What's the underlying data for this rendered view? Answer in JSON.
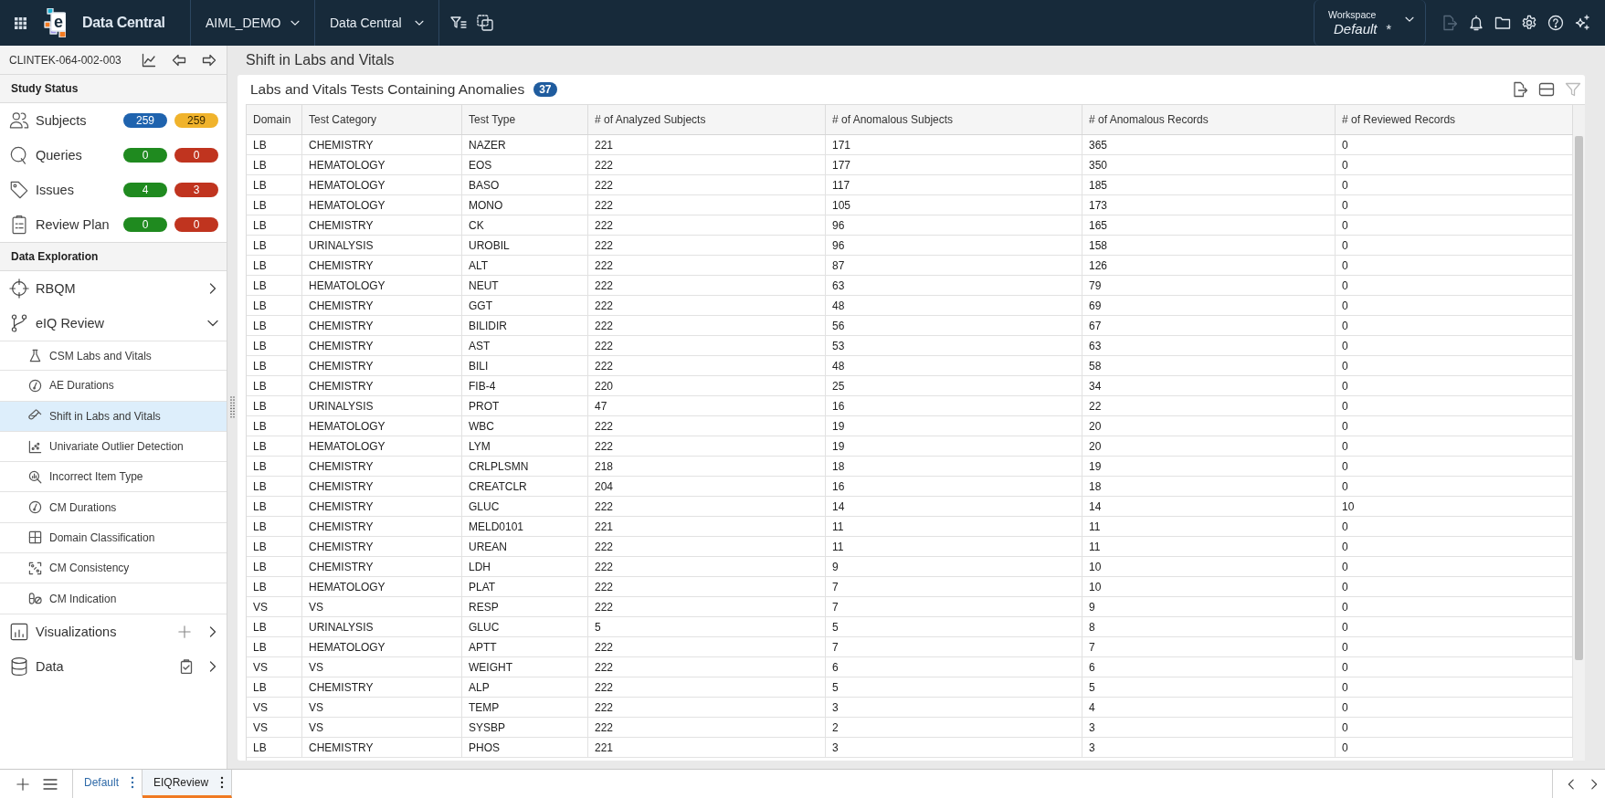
{
  "top_bar": {
    "logo_letter": "e",
    "app_name": "Data Central",
    "selectors": [
      {
        "value": "AIML_DEMO"
      },
      {
        "value": "Data Central"
      }
    ],
    "workspace": {
      "label": "Workspace",
      "value": "Default",
      "unsaved_mark": "*"
    },
    "export_disabled": true
  },
  "sidebar": {
    "study_id": "CLINTEK-064-002-003",
    "status_title": "Study Status",
    "status_items": [
      {
        "kind": "subjects",
        "label": "Subjects",
        "counts": [
          {
            "value": "259",
            "color": "#1f63ae"
          },
          {
            "value": "259",
            "color": "#f0b32c"
          }
        ]
      },
      {
        "kind": "queries",
        "label": "Queries",
        "counts": [
          {
            "value": "0",
            "color": "#1f8a1f"
          },
          {
            "value": "0",
            "color": "#c0341f"
          }
        ]
      },
      {
        "kind": "issues",
        "label": "Issues",
        "counts": [
          {
            "value": "4",
            "color": "#1f8a1f"
          },
          {
            "value": "3",
            "color": "#c0341f"
          }
        ]
      },
      {
        "kind": "review_plan",
        "label": "Review Plan",
        "counts": [
          {
            "value": "0",
            "color": "#1f8a1f"
          },
          {
            "value": "0",
            "color": "#c0341f"
          }
        ]
      }
    ],
    "exploration_title": "Data Exploration",
    "nav_items": [
      {
        "kind": "rbqm",
        "label": "RBQM",
        "expanded": false
      },
      {
        "kind": "eiq",
        "label": "eIQ Review",
        "expanded": true,
        "children": [
          {
            "kind": "flask",
            "label": "CSM Labs and Vitals",
            "selected": false
          },
          {
            "kind": "stopwatch",
            "label": "AE Durations",
            "selected": false
          },
          {
            "kind": "tube",
            "label": "Shift in Labs and Vitals",
            "selected": true
          },
          {
            "kind": "scatter",
            "label": "Univariate Outlier Detection",
            "selected": false
          },
          {
            "kind": "search_chart",
            "label": "Incorrect Item Type",
            "selected": false
          },
          {
            "kind": "stopwatch",
            "label": "CM Durations",
            "selected": false
          },
          {
            "kind": "grid",
            "label": "Domain Classification",
            "selected": false
          },
          {
            "kind": "frame",
            "label": "CM Consistency",
            "selected": false
          },
          {
            "kind": "pill",
            "label": "CM Indication",
            "selected": false
          }
        ]
      },
      {
        "kind": "visualizations",
        "label": "Visualizations",
        "expanded": false
      },
      {
        "kind": "data",
        "label": "Data",
        "expanded": false
      }
    ]
  },
  "page_title": "Shift in Labs and Vitals",
  "card": {
    "title": "Labs and Vitals Tests Containing Anomalies",
    "count": "37",
    "filter_disabled": true,
    "table": {
      "columns": [
        "Domain",
        "Test Category",
        "Test Type",
        "# of Analyzed Subjects",
        "# of Anomalous Subjects",
        "# of Anomalous Records",
        "# of Reviewed Records"
      ],
      "rows": [
        [
          "LB",
          "CHEMISTRY",
          "NAZER",
          "221",
          "171",
          "365",
          "0"
        ],
        [
          "LB",
          "HEMATOLOGY",
          "EOS",
          "222",
          "177",
          "350",
          "0"
        ],
        [
          "LB",
          "HEMATOLOGY",
          "BASO",
          "222",
          "117",
          "185",
          "0"
        ],
        [
          "LB",
          "HEMATOLOGY",
          "MONO",
          "222",
          "105",
          "173",
          "0"
        ],
        [
          "LB",
          "CHEMISTRY",
          "CK",
          "222",
          "96",
          "165",
          "0"
        ],
        [
          "LB",
          "URINALYSIS",
          "UROBIL",
          "222",
          "96",
          "158",
          "0"
        ],
        [
          "LB",
          "CHEMISTRY",
          "ALT",
          "222",
          "87",
          "126",
          "0"
        ],
        [
          "LB",
          "HEMATOLOGY",
          "NEUT",
          "222",
          "63",
          "79",
          "0"
        ],
        [
          "LB",
          "CHEMISTRY",
          "GGT",
          "222",
          "48",
          "69",
          "0"
        ],
        [
          "LB",
          "CHEMISTRY",
          "BILIDIR",
          "222",
          "56",
          "67",
          "0"
        ],
        [
          "LB",
          "CHEMISTRY",
          "AST",
          "222",
          "53",
          "63",
          "0"
        ],
        [
          "LB",
          "CHEMISTRY",
          "BILI",
          "222",
          "48",
          "58",
          "0"
        ],
        [
          "LB",
          "CHEMISTRY",
          "FIB-4",
          "220",
          "25",
          "34",
          "0"
        ],
        [
          "LB",
          "URINALYSIS",
          "PROT",
          "47",
          "16",
          "22",
          "0"
        ],
        [
          "LB",
          "HEMATOLOGY",
          "WBC",
          "222",
          "19",
          "20",
          "0"
        ],
        [
          "LB",
          "HEMATOLOGY",
          "LYM",
          "222",
          "19",
          "20",
          "0"
        ],
        [
          "LB",
          "CHEMISTRY",
          "CRLPLSMN",
          "218",
          "18",
          "19",
          "0"
        ],
        [
          "LB",
          "CHEMISTRY",
          "CREATCLR",
          "204",
          "16",
          "18",
          "0"
        ],
        [
          "LB",
          "CHEMISTRY",
          "GLUC",
          "222",
          "14",
          "14",
          "10"
        ],
        [
          "LB",
          "CHEMISTRY",
          "MELD0101",
          "221",
          "11",
          "11",
          "0"
        ],
        [
          "LB",
          "CHEMISTRY",
          "UREAN",
          "222",
          "11",
          "11",
          "0"
        ],
        [
          "LB",
          "CHEMISTRY",
          "LDH",
          "222",
          "9",
          "10",
          "0"
        ],
        [
          "LB",
          "HEMATOLOGY",
          "PLAT",
          "222",
          "7",
          "10",
          "0"
        ],
        [
          "VS",
          "VS",
          "RESP",
          "222",
          "7",
          "9",
          "0"
        ],
        [
          "LB",
          "URINALYSIS",
          "GLUC",
          "5",
          "5",
          "8",
          "0"
        ],
        [
          "LB",
          "HEMATOLOGY",
          "APTT",
          "222",
          "7",
          "7",
          "0"
        ],
        [
          "VS",
          "VS",
          "WEIGHT",
          "222",
          "6",
          "6",
          "0"
        ],
        [
          "LB",
          "CHEMISTRY",
          "ALP",
          "222",
          "5",
          "5",
          "0"
        ],
        [
          "VS",
          "VS",
          "TEMP",
          "222",
          "3",
          "4",
          "0"
        ],
        [
          "VS",
          "VS",
          "SYSBP",
          "222",
          "2",
          "3",
          "0"
        ],
        [
          "LB",
          "CHEMISTRY",
          "PHOS",
          "221",
          "3",
          "3",
          "0"
        ]
      ]
    }
  },
  "bottom_bar": {
    "tabs": [
      {
        "label": "Default",
        "selected": false
      },
      {
        "label": "EIQReview",
        "selected": true
      }
    ]
  }
}
